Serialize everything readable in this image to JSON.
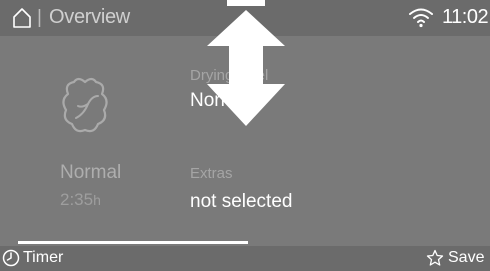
{
  "header": {
    "title_separator": "|",
    "title": "Overview",
    "time": "11:02",
    "icons": {
      "home": "home-icon",
      "wifi": "wifi-icon"
    }
  },
  "program": {
    "icon": "cotton-shirt-icon",
    "name": "Normal",
    "duration_value": "2:35",
    "duration_unit": "h"
  },
  "drying_level": {
    "label": "Drying level",
    "value": "Normal"
  },
  "extras": {
    "label": "Extras",
    "value": "not selected"
  },
  "overlay": {
    "icon": "scroll-up-down-arrow-icon"
  },
  "footer": {
    "timer_label": "Timer",
    "save_label": "Save",
    "icons": {
      "timer": "clock-icon",
      "save": "star-icon"
    }
  },
  "colors": {
    "background": "#7a7a7a",
    "bar": "#6b6b6b",
    "text": "#ffffff",
    "muted_text": "#a5a5a5"
  }
}
